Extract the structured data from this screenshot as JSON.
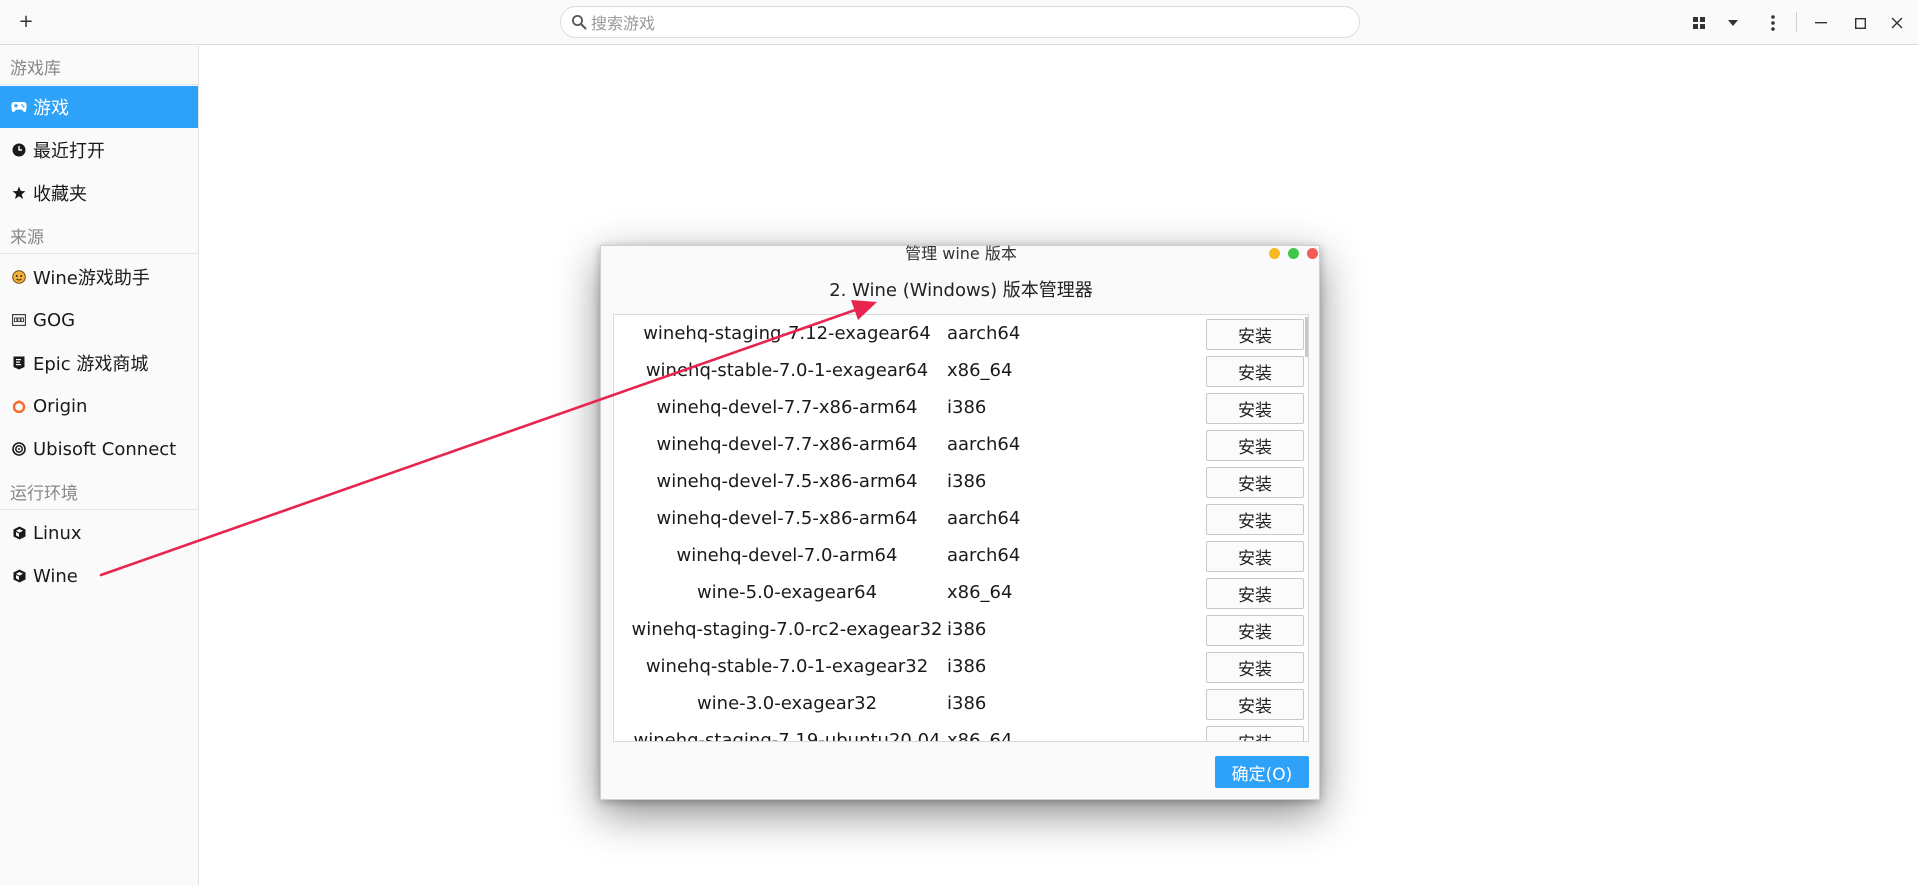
{
  "titlebar": {
    "add_label": "+",
    "search_placeholder": "搜索游戏",
    "icons": [
      "grid-view-icon",
      "dropdown-icon",
      "more-menu-icon",
      "minimize-icon",
      "maximize-icon",
      "close-icon"
    ]
  },
  "sidebar": {
    "sections": {
      "library": "游戏库",
      "sources": "来源",
      "runtimes": "运行环境"
    },
    "library_items": [
      {
        "label": "游戏",
        "icon": "gamepad-icon",
        "active": true
      },
      {
        "label": "最近打开",
        "icon": "clock-icon",
        "active": false
      },
      {
        "label": "收藏夹",
        "icon": "star-icon",
        "active": false
      }
    ],
    "source_items": [
      {
        "label": "Wine游戏助手",
        "icon": "wine-helper-icon"
      },
      {
        "label": "GOG",
        "icon": "gog-icon"
      },
      {
        "label": "Epic 游戏商城",
        "icon": "epic-icon"
      },
      {
        "label": "Origin",
        "icon": "origin-icon"
      },
      {
        "label": "Ubisoft Connect",
        "icon": "ubisoft-icon"
      }
    ],
    "runtime_items": [
      {
        "label": "Linux",
        "icon": "cube-icon"
      },
      {
        "label": "Wine",
        "icon": "cube-icon"
      }
    ]
  },
  "dialog": {
    "title": "管理 wine 版本",
    "heading": "2. Wine (Windows) 版本管理器",
    "install_label": "安装",
    "ok_label": "确定(O)",
    "rows": [
      {
        "name": "winehq-staging-7.12-exagear64",
        "arch": "aarch64"
      },
      {
        "name": "winehq-stable-7.0-1-exagear64",
        "arch": "x86_64"
      },
      {
        "name": "winehq-devel-7.7-x86-arm64",
        "arch": "i386"
      },
      {
        "name": "winehq-devel-7.7-x86-arm64",
        "arch": "aarch64"
      },
      {
        "name": "winehq-devel-7.5-x86-arm64",
        "arch": "i386"
      },
      {
        "name": "winehq-devel-7.5-x86-arm64",
        "arch": "aarch64"
      },
      {
        "name": "winehq-devel-7.0-arm64",
        "arch": "aarch64"
      },
      {
        "name": "wine-5.0-exagear64",
        "arch": "x86_64"
      },
      {
        "name": "winehq-staging-7.0-rc2-exagear32",
        "arch": "i386"
      },
      {
        "name": "winehq-stable-7.0-1-exagear32",
        "arch": "i386"
      },
      {
        "name": "wine-3.0-exagear32",
        "arch": "i386"
      },
      {
        "name": "winehq-staging-7.19-ubuntu20.04",
        "arch": "x86_64"
      }
    ]
  },
  "colors": {
    "accent": "#2ea1f8",
    "annotation_arrow": "#e8254f",
    "win_minimize": "#f5b922",
    "win_maximize": "#3fc64d",
    "win_close": "#f15b58"
  }
}
